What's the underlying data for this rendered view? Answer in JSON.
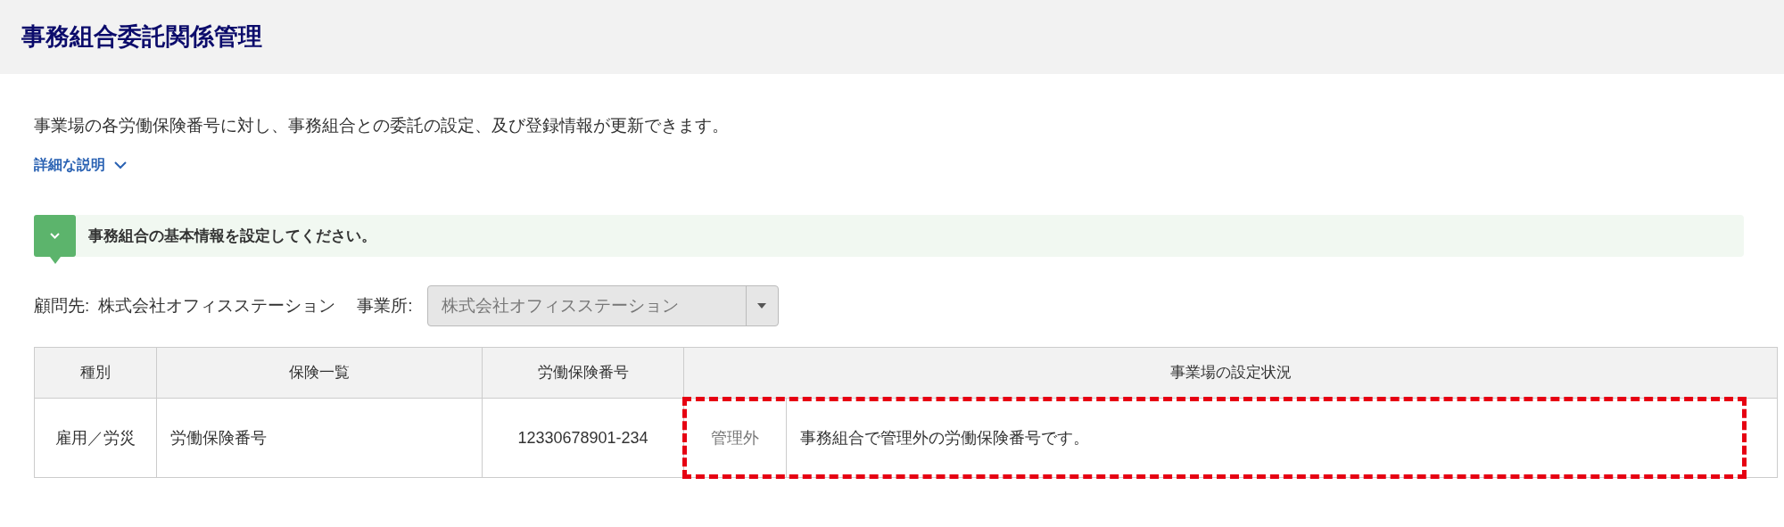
{
  "page_title": "事務組合委託関係管理",
  "description": "事業場の各労働保険番号に対し、事務組合との委託の設定、及び登録情報が更新できます。",
  "details_link": {
    "label": "詳細な説明",
    "expanded": false
  },
  "step": {
    "label": "事務組合の基本情報を設定してください。",
    "expanded": true
  },
  "client": {
    "label": "顧問先:",
    "value": "株式会社オフィスステーション"
  },
  "office": {
    "label": "事業所:",
    "value": "株式会社オフィスステーション",
    "disabled": true
  },
  "table": {
    "columns": [
      "種別",
      "保険一覧",
      "労働保険番号",
      "事業場の設定状況"
    ],
    "rows": [
      {
        "type": "雇用／労災",
        "insurance": "労働保険番号",
        "number": "12330678901-234",
        "status": "管理外",
        "status_text": "事務組合で管理外の労働保険番号です。",
        "highlighted": true
      }
    ]
  }
}
